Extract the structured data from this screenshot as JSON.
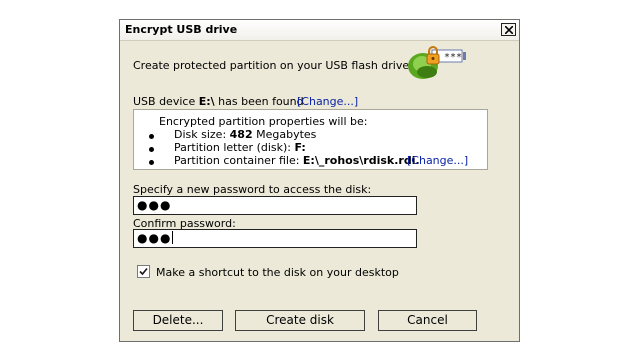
{
  "window": {
    "title": "Encrypt USB drive",
    "subtitle": "Create protected partition on your USB flash drive.",
    "logo_mask": "***"
  },
  "device": {
    "prefix": "USB device ",
    "drive": "E:\\",
    "suffix": " has been found",
    "change_link": "[Change...]"
  },
  "properties": {
    "header": "Encrypted partition properties will be:",
    "disk_size_label": "Disk size: ",
    "disk_size_value": "482",
    "disk_size_unit": " Megabytes",
    "letter_label": "Partition letter (disk): ",
    "letter_value": "F:",
    "container_label": "Partition container file: ",
    "container_value": "E:\\_rohos\\rdisk.rdi.",
    "container_change": "[Change...]"
  },
  "password": {
    "label": "Specify a new password to access the disk:",
    "value": "●●●",
    "confirm_label": "Confirm password:",
    "confirm_value": "●●●"
  },
  "shortcut": {
    "checked": true,
    "label": "Make a shortcut to the disk on your desktop"
  },
  "buttons": {
    "delete": "Delete...",
    "create": "Create disk",
    "cancel": "Cancel"
  },
  "colors": {
    "link": "#0a23a6",
    "logo_green": "#5aa81e",
    "lock_orange": "#f0a020"
  },
  "icons": [
    "close-icon",
    "usb-lock-logo-icon",
    "checkmark-icon"
  ]
}
